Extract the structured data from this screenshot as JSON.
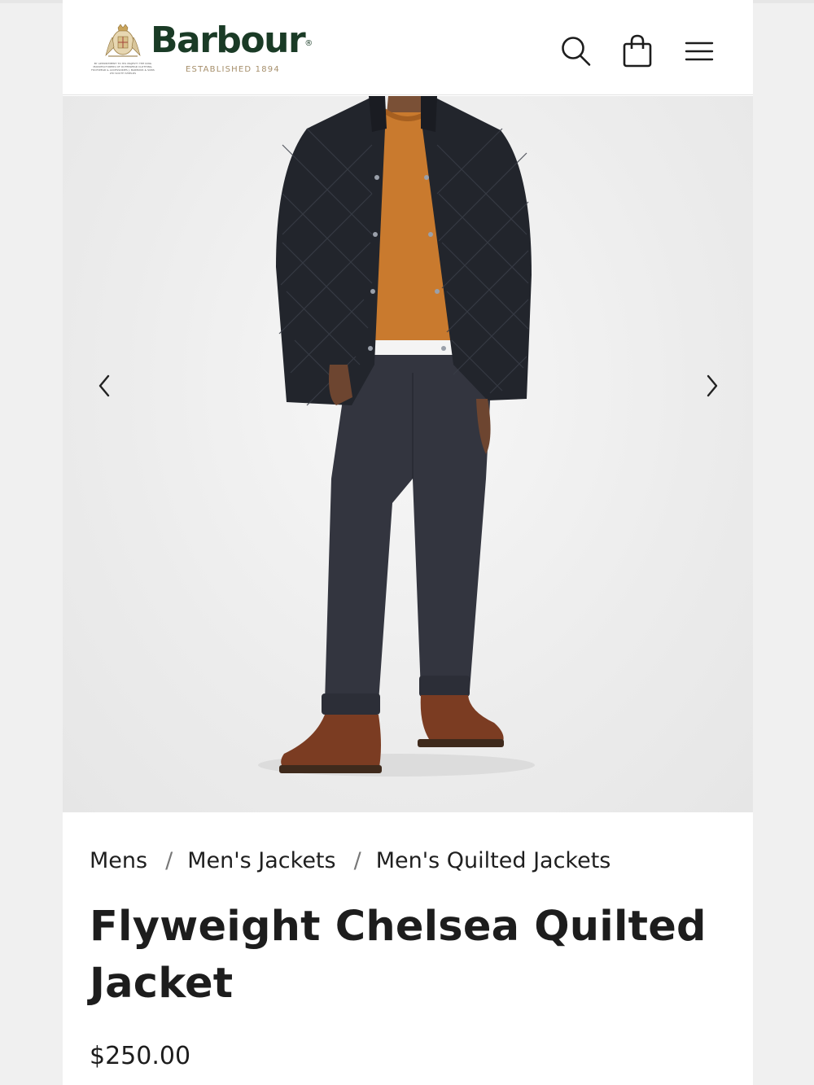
{
  "header": {
    "brand": "Barbour",
    "established": "ESTABLISHED 1894",
    "warrant_text": "BY APPOINTMENT TO HIS MAJESTY THE KING MANUFACTURERS OF OUTERWEAR CLOTHING, FOOTWEAR & ACCESSORIES J. BARBOUR & SONS LTD SOUTH SHIELDS",
    "icons": [
      "search-icon",
      "shopping-bag-icon",
      "hamburger-menu-icon"
    ]
  },
  "gallery": {
    "prev_icon": "chevron-left-icon",
    "next_icon": "chevron-right-icon"
  },
  "breadcrumb": {
    "items": [
      "Mens",
      "Men's Jackets",
      "Men's Quilted Jackets"
    ],
    "separator": "/"
  },
  "product": {
    "title": "Flyweight Chelsea Quilted Jacket",
    "price": "$250.00"
  },
  "colors": {
    "brand_green": "#1a3b26",
    "established_gold": "#a58e6a",
    "text": "#1d1d1d"
  }
}
